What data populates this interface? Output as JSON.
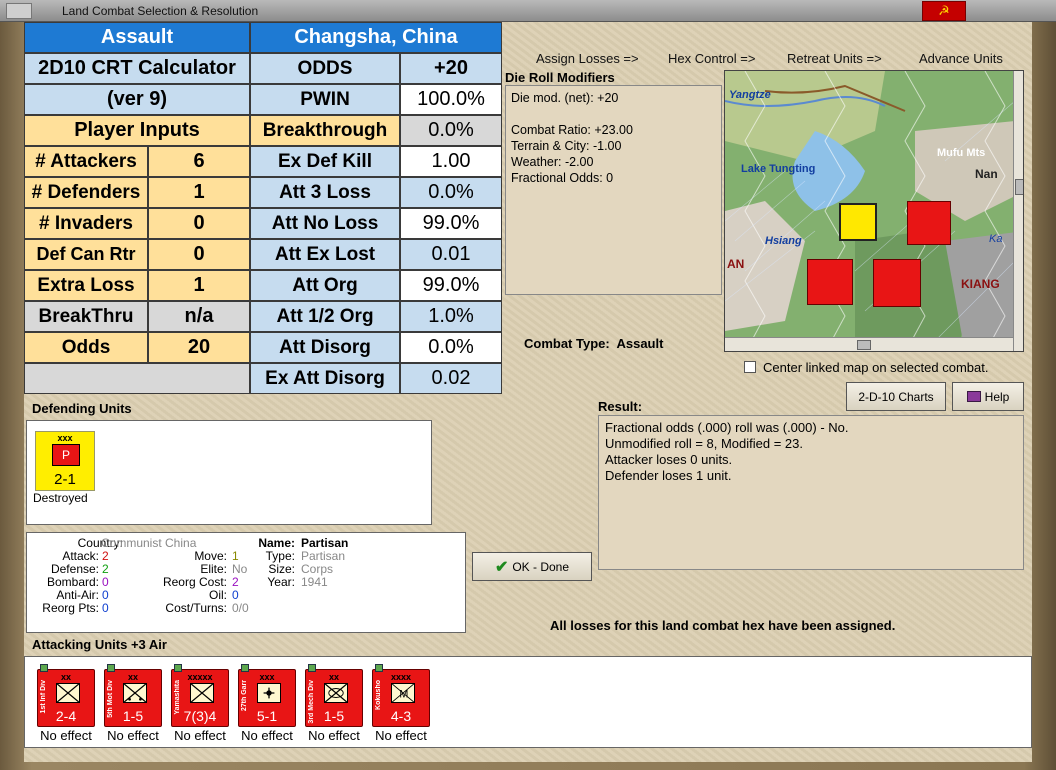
{
  "window": {
    "title": "Land Combat Selection & Resolution"
  },
  "crt": {
    "assault": "Assault",
    "location": "Changsha, China",
    "calc_title": "2D10 CRT Calculator",
    "calc_ver": "(ver 9)",
    "player_inputs": "Player Inputs",
    "inputs": [
      {
        "label": "# Attackers",
        "value": "6"
      },
      {
        "label": "# Defenders",
        "value": "1"
      },
      {
        "label": "# Invaders",
        "value": "0"
      },
      {
        "label": "Def Can Rtr",
        "value": "0"
      },
      {
        "label": "Extra Loss",
        "value": "1"
      },
      {
        "label": "BreakThru",
        "value": "n/a"
      },
      {
        "label": "Odds",
        "value": "20"
      }
    ],
    "results": [
      {
        "label": "ODDS",
        "value": "+20"
      },
      {
        "label": "PWIN",
        "value": "100.0%"
      },
      {
        "label": "Breakthrough",
        "value": "0.0%"
      },
      {
        "label": "Ex Def Kill",
        "value": "1.00"
      },
      {
        "label": "Att 3 Loss",
        "value": "0.0%"
      },
      {
        "label": "Att No Loss",
        "value": "99.0%"
      },
      {
        "label": "Att Ex Lost",
        "value": "0.01"
      },
      {
        "label": "Att Org",
        "value": "99.0%"
      },
      {
        "label": "Att 1/2 Org",
        "value": "1.0%"
      },
      {
        "label": "Att Disorg",
        "value": "0.0%"
      },
      {
        "label": "Ex Att Disorg",
        "value": "0.02"
      }
    ]
  },
  "steps": [
    "Assign Losses =>",
    "Hex Control =>",
    "Retreat Units =>",
    "Advance Units"
  ],
  "die_roll": {
    "title": "Die Roll Modifiers",
    "lines": [
      "Die mod. (net): +20",
      "",
      "Combat Ratio: +23.00",
      "Terrain & City: -1.00",
      "Weather: -2.00",
      "Fractional Odds: 0"
    ]
  },
  "combat_type": {
    "label": "Combat Type:",
    "value": "Assault"
  },
  "map": {
    "labels": [
      "Yangtze",
      "Lake Tungting",
      "Mufu Mts",
      "Nan",
      "Hsiang",
      "AN",
      "KIANG",
      "Ka"
    ],
    "center_checkbox": "Center linked map on selected combat."
  },
  "buttons": {
    "charts": "2-D-10 Charts",
    "help": "Help",
    "ok": "OK - Done"
  },
  "result": {
    "title": "Result:",
    "lines": [
      "Fractional odds (.000) roll was (.000)  - No.",
      "Unmodified roll = 8, Modified = 23.",
      "Attacker loses 0 units.",
      "Defender loses 1 unit."
    ]
  },
  "defending": {
    "title": "Defending Units",
    "unit": {
      "top": "xxx",
      "sym": "P",
      "str": "2-1",
      "status": "Destroyed"
    }
  },
  "unit_info": {
    "country_label": "Country:",
    "country": "Communist China",
    "attack_label": "Attack:",
    "attack": "2",
    "defense_label": "Defense:",
    "defense": "2",
    "bombard_label": "Bombard:",
    "bombard": "0",
    "antiair_label": "Anti-Air:",
    "antiair": "0",
    "reorg_label": "Reorg Pts:",
    "reorg": "0",
    "move_label": "Move:",
    "move": "1",
    "elite_label": "Elite:",
    "elite": "No",
    "reorgcost_label": "Reorg Cost:",
    "reorgcost": "2",
    "oil_label": "Oil:",
    "oil": "0",
    "costturns_label": "Cost/Turns:",
    "costturns": "0/0",
    "name_label": "Name:",
    "name": "Partisan",
    "type_label": "Type:",
    "type": "Partisan",
    "size_label": "Size:",
    "size": "Corps",
    "year_label": "Year:",
    "year": "1941"
  },
  "losses_note": "All losses for this land combat hex have been assigned.",
  "attacking": {
    "title": "Attacking Units +3 Air",
    "units": [
      {
        "top": "xx",
        "side": "1st Inf Div",
        "str": "2-4",
        "kind": "inf",
        "effect": "No effect"
      },
      {
        "top": "xx",
        "side": "5th Mot Div",
        "str": "1-5",
        "kind": "mot",
        "effect": "No effect"
      },
      {
        "top": "xxxxx",
        "side": "Yamashita",
        "str": "7(3)4",
        "kind": "inf",
        "effect": "No effect"
      },
      {
        "top": "xxx",
        "side": "27th Garr",
        "str": "5-1",
        "kind": "garr",
        "effect": "No effect"
      },
      {
        "top": "xx",
        "side": "3rd Mech Div",
        "str": "1-5",
        "kind": "mech",
        "effect": "No effect"
      },
      {
        "top": "xxxx",
        "side": "Kokusho",
        "str": "4-3",
        "kind": "m",
        "effect": "No effect"
      }
    ]
  }
}
